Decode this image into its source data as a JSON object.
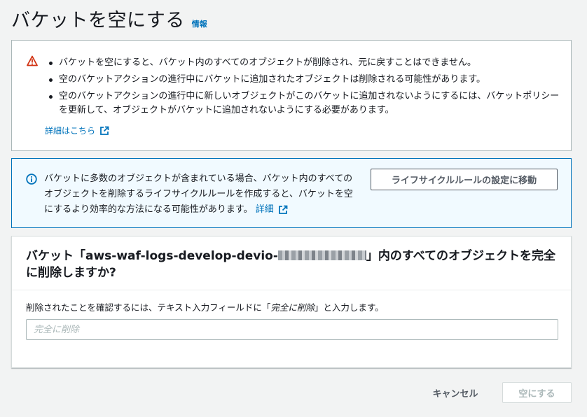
{
  "header": {
    "title": "バケットを空にする",
    "info_link": "情報"
  },
  "warning": {
    "icon": "warning-icon",
    "color": "#d13212",
    "items": [
      "バケットを空にすると、バケット内のすべてのオブジェクトが削除され、元に戻すことはできません。",
      "空のバケットアクションの進行中にバケットに追加されたオブジェクトは削除される可能性があります。",
      "空のバケットアクションの進行中に新しいオブジェクトがこのバケットに追加されないようにするには、バケットポリシーを更新して、オブジェクトがバケットに追加されないようにする必要があります。"
    ],
    "learn_more": "詳細はこちら"
  },
  "info": {
    "icon": "info-icon",
    "color": "#0073bb",
    "text": "バケットに多数のオブジェクトが含まれている場合、バケット内のすべてのオブジェクトを削除するライフサイクルルールを作成すると、バケットを空にするより効率的な方法になる可能性があります。",
    "detail_link": "詳細",
    "button_label": "ライフサイクルルールの設定に移動"
  },
  "confirm": {
    "title_prefix": "バケット「aws-waf-logs-develop-devio-",
    "title_suffix": "」内のすべてのオブジェクトを完全に削除しますか?",
    "label_prefix": "削除されたことを確認するには、テキスト入力フィールドに「",
    "label_keyword": "完全に削除",
    "label_suffix": "」と入力します。",
    "input_value": "",
    "input_placeholder": "完全に削除"
  },
  "footer": {
    "cancel_label": "キャンセル",
    "empty_label": "空にする"
  }
}
